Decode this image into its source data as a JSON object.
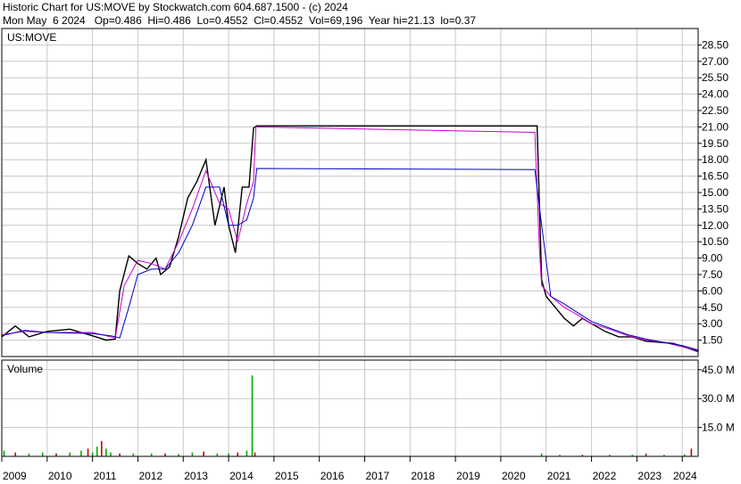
{
  "header": {
    "line1": "Historic Chart for US:MOVE by Stockwatch.com 604.687.1500 - (c) 2024",
    "line2": "Mon May  6 2024   Op=0.486  Hi=0.486  Lo=0.4552  Cl=0.4552  Vol=69,196  Year hi=21.13  lo=0.37"
  },
  "chart_data": [
    {
      "type": "line",
      "title": "US:MOVE",
      "ylim": [
        0,
        30
      ],
      "yticks": [
        "28.50",
        "27.00",
        "25.50",
        "24.00",
        "22.50",
        "21.00",
        "19.50",
        "18.00",
        "16.50",
        "15.00",
        "13.50",
        "12.00",
        "10.50",
        "9.00",
        "7.50",
        "6.00",
        "4.50",
        "3.00",
        "1.50"
      ],
      "x_labels": [
        "2009",
        "2010",
        "2011",
        "2012",
        "2013",
        "2014",
        "2015",
        "2016",
        "2017",
        "2018",
        "2019",
        "2020",
        "2021",
        "2022",
        "2023",
        "2024"
      ],
      "grid": true,
      "series": [
        {
          "color": "#000000",
          "x": [
            2009.0,
            2009.3,
            2009.6,
            2010.0,
            2010.5,
            2011.0,
            2011.3,
            2011.5,
            2011.6,
            2011.8,
            2012.0,
            2012.2,
            2012.4,
            2012.5,
            2012.7,
            2012.9,
            2013.1,
            2013.3,
            2013.5,
            2013.7,
            2013.9,
            2014.0,
            2014.15,
            2014.3,
            2014.45,
            2014.55,
            2014.62,
            2020.8,
            2020.9,
            2021.0,
            2021.2,
            2021.4,
            2021.6,
            2021.8,
            2022.0,
            2022.3,
            2022.6,
            2022.9,
            2023.2,
            2023.5,
            2023.8,
            2024.1,
            2024.35
          ],
          "y": [
            1.8,
            2.8,
            1.8,
            2.3,
            2.5,
            1.9,
            1.5,
            1.6,
            6.0,
            9.2,
            8.5,
            8.0,
            9.0,
            7.5,
            8.2,
            11.0,
            14.5,
            16.0,
            18.0,
            12.0,
            15.5,
            12.0,
            9.5,
            15.5,
            15.5,
            20.9,
            21.1,
            21.1,
            7.0,
            5.5,
            4.5,
            3.5,
            2.8,
            3.5,
            3.0,
            2.3,
            1.8,
            1.8,
            1.4,
            1.3,
            1.2,
            0.8,
            0.46
          ]
        },
        {
          "color": "#cc00cc",
          "x": [
            2009.0,
            2009.5,
            2010.0,
            2011.0,
            2011.5,
            2011.7,
            2012.0,
            2012.3,
            2012.6,
            2012.9,
            2013.2,
            2013.5,
            2013.8,
            2014.0,
            2014.2,
            2014.4,
            2014.55,
            2014.6,
            2020.75,
            2020.85,
            2020.9,
            2021.1,
            2021.4,
            2021.7,
            2022.0,
            2022.4,
            2022.8,
            2023.2,
            2023.6,
            2024.0,
            2024.35
          ],
          "y": [
            2.0,
            2.3,
            2.2,
            2.2,
            1.7,
            6.5,
            8.8,
            8.5,
            8.0,
            10.5,
            13.5,
            17.0,
            14.0,
            13.5,
            10.5,
            14.0,
            16.0,
            21.0,
            20.5,
            10.0,
            6.5,
            5.5,
            4.5,
            3.8,
            3.0,
            2.5,
            1.9,
            1.5,
            1.3,
            0.9,
            0.55
          ]
        },
        {
          "color": "#0000cc",
          "x": [
            2009.0,
            2009.5,
            2010.0,
            2011.0,
            2011.4,
            2011.6,
            2011.8,
            2012.0,
            2012.3,
            2012.6,
            2012.9,
            2013.2,
            2013.5,
            2013.8,
            2014.0,
            2014.2,
            2014.4,
            2014.55,
            2014.62,
            2020.75,
            2020.9,
            2021.1,
            2021.4,
            2021.7,
            2022.0,
            2022.4,
            2022.8,
            2023.2,
            2023.6,
            2024.0,
            2024.35
          ],
          "y": [
            1.9,
            2.4,
            2.2,
            2.1,
            1.9,
            1.7,
            4.5,
            7.5,
            8.0,
            8.0,
            9.5,
            12.0,
            15.5,
            15.5,
            12.0,
            12.0,
            12.5,
            14.5,
            17.2,
            17.1,
            12.0,
            5.5,
            4.8,
            4.0,
            3.2,
            2.6,
            2.0,
            1.6,
            1.3,
            1.0,
            0.6
          ]
        }
      ]
    },
    {
      "type": "bar",
      "title": "Volume",
      "ylim": [
        0,
        50
      ],
      "yticks": [
        "45.0 M",
        "30.0 M",
        "15.0 M"
      ],
      "unit": "M",
      "bars": [
        {
          "x": 2009.05,
          "v": 3
        },
        {
          "x": 2009.3,
          "v": 2
        },
        {
          "x": 2009.6,
          "v": 1.5
        },
        {
          "x": 2009.9,
          "v": 2
        },
        {
          "x": 2010.2,
          "v": 1.5
        },
        {
          "x": 2010.5,
          "v": 2
        },
        {
          "x": 2010.75,
          "v": 3
        },
        {
          "x": 2010.9,
          "v": 4
        },
        {
          "x": 2011.0,
          "v": 2
        },
        {
          "x": 2011.1,
          "v": 5
        },
        {
          "x": 2011.2,
          "v": 8
        },
        {
          "x": 2011.3,
          "v": 4
        },
        {
          "x": 2011.4,
          "v": 2
        },
        {
          "x": 2011.6,
          "v": 1.5
        },
        {
          "x": 2011.9,
          "v": 1.5
        },
        {
          "x": 2012.3,
          "v": 1.5
        },
        {
          "x": 2012.6,
          "v": 1.5
        },
        {
          "x": 2012.9,
          "v": 1.2
        },
        {
          "x": 2013.2,
          "v": 2
        },
        {
          "x": 2013.45,
          "v": 2.5
        },
        {
          "x": 2013.75,
          "v": 1.5
        },
        {
          "x": 2014.0,
          "v": 1.5
        },
        {
          "x": 2014.2,
          "v": 2
        },
        {
          "x": 2014.4,
          "v": 3
        },
        {
          "x": 2014.52,
          "v": 42
        },
        {
          "x": 2014.58,
          "v": 2
        },
        {
          "x": 2020.9,
          "v": 1.5
        },
        {
          "x": 2021.3,
          "v": 0.8
        },
        {
          "x": 2021.8,
          "v": 0.8
        },
        {
          "x": 2022.4,
          "v": 0.8
        },
        {
          "x": 2022.9,
          "v": 0.8
        },
        {
          "x": 2023.2,
          "v": 1.5
        },
        {
          "x": 2023.6,
          "v": 0.8
        },
        {
          "x": 2024.05,
          "v": 1
        },
        {
          "x": 2024.2,
          "v": 4
        }
      ]
    }
  ]
}
